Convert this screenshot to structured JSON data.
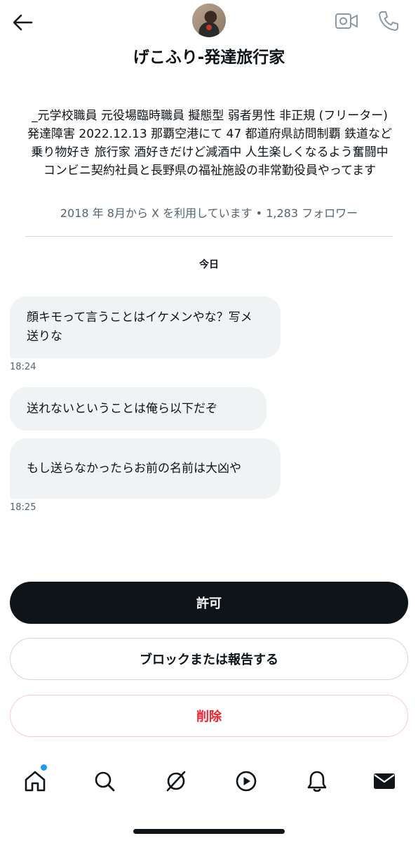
{
  "header": {
    "back_icon": "arrow-left-icon",
    "video_icon": "video-camera-icon",
    "call_icon": "phone-icon",
    "display_name": "げこふり-発達旅行家"
  },
  "profile": {
    "bio": "_元学校職員 元役場臨時職員 擬態型 弱者男性 非正規 (フリーター) 発達障害 2022.12.13 那覇空港にて 47 都道府県訪問制覇 鉄道など乗り物好き 旅行家 酒好きだけど減酒中 人生楽しくなるよう奮闘中 コンビニ契約社員と長野県の福祉施設の非常勤役員やってます",
    "meta": "2018 年 8月から X を利用しています • 1,283 フォロワー"
  },
  "conversation": {
    "date_label": "今日",
    "messages": [
      {
        "text": "顔キモって言うことはイケメンやな？写メ送りな",
        "time": "18:24"
      },
      {
        "text": "送れないということは俺ら以下だぞ"
      },
      {
        "text": "もし送らなかったらお前の名前は大凶や",
        "time": "18:25"
      }
    ]
  },
  "actions": {
    "allow_label": "許可",
    "block_label": "ブロックまたは報告する",
    "delete_label": "削除"
  },
  "tabbar": {
    "icons": [
      "home-icon",
      "search-icon",
      "grok-icon",
      "video-play-icon",
      "bell-icon",
      "mail-icon"
    ]
  },
  "colors": {
    "text": "#0f1419",
    "secondary": "#536471",
    "bubble": "#eff3f4",
    "accent": "#1d9bf0",
    "danger": "#f4212e"
  }
}
